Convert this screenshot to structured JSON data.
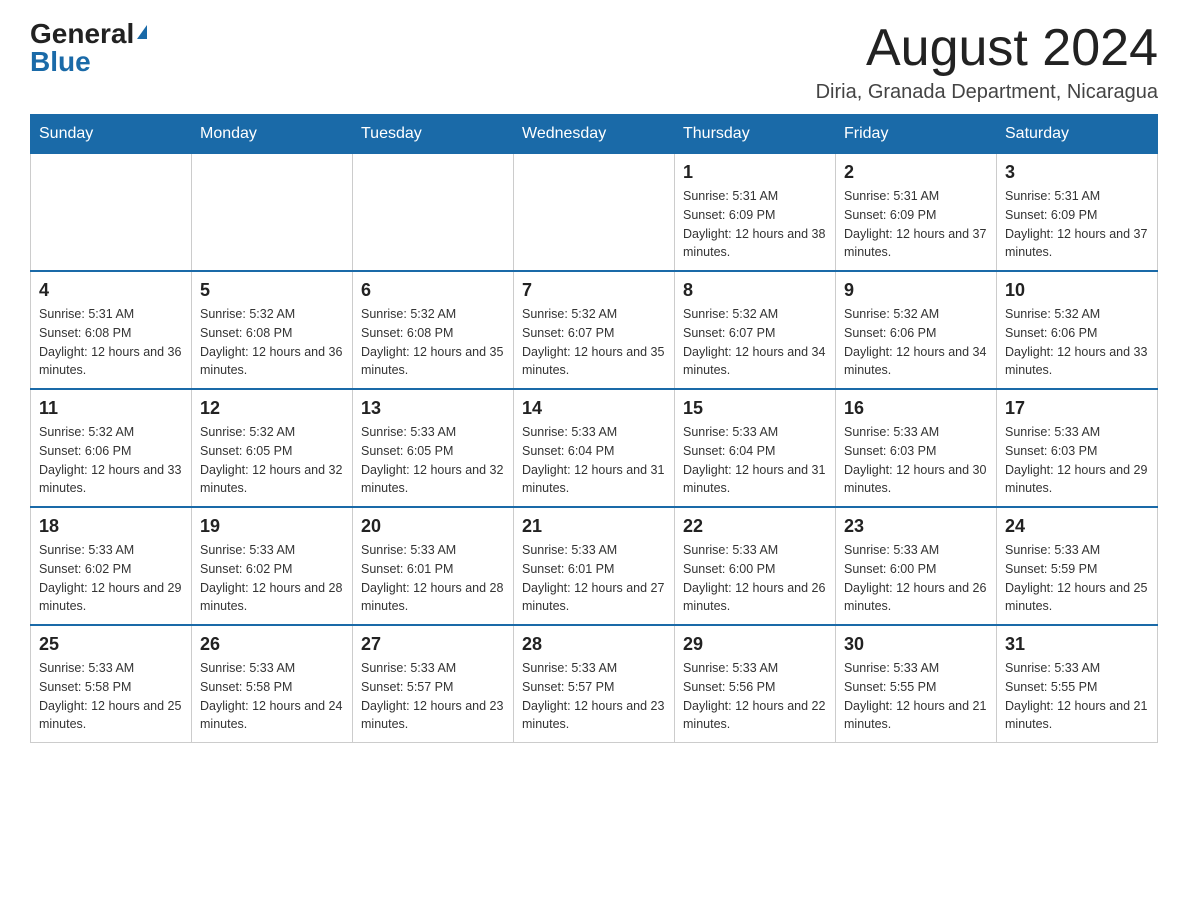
{
  "header": {
    "logo_general": "General",
    "logo_blue": "Blue",
    "title": "August 2024",
    "subtitle": "Diria, Granada Department, Nicaragua"
  },
  "days_of_week": [
    "Sunday",
    "Monday",
    "Tuesday",
    "Wednesday",
    "Thursday",
    "Friday",
    "Saturday"
  ],
  "weeks": [
    [
      {
        "day": "",
        "info": ""
      },
      {
        "day": "",
        "info": ""
      },
      {
        "day": "",
        "info": ""
      },
      {
        "day": "",
        "info": ""
      },
      {
        "day": "1",
        "info": "Sunrise: 5:31 AM\nSunset: 6:09 PM\nDaylight: 12 hours and 38 minutes."
      },
      {
        "day": "2",
        "info": "Sunrise: 5:31 AM\nSunset: 6:09 PM\nDaylight: 12 hours and 37 minutes."
      },
      {
        "day": "3",
        "info": "Sunrise: 5:31 AM\nSunset: 6:09 PM\nDaylight: 12 hours and 37 minutes."
      }
    ],
    [
      {
        "day": "4",
        "info": "Sunrise: 5:31 AM\nSunset: 6:08 PM\nDaylight: 12 hours and 36 minutes."
      },
      {
        "day": "5",
        "info": "Sunrise: 5:32 AM\nSunset: 6:08 PM\nDaylight: 12 hours and 36 minutes."
      },
      {
        "day": "6",
        "info": "Sunrise: 5:32 AM\nSunset: 6:08 PM\nDaylight: 12 hours and 35 minutes."
      },
      {
        "day": "7",
        "info": "Sunrise: 5:32 AM\nSunset: 6:07 PM\nDaylight: 12 hours and 35 minutes."
      },
      {
        "day": "8",
        "info": "Sunrise: 5:32 AM\nSunset: 6:07 PM\nDaylight: 12 hours and 34 minutes."
      },
      {
        "day": "9",
        "info": "Sunrise: 5:32 AM\nSunset: 6:06 PM\nDaylight: 12 hours and 34 minutes."
      },
      {
        "day": "10",
        "info": "Sunrise: 5:32 AM\nSunset: 6:06 PM\nDaylight: 12 hours and 33 minutes."
      }
    ],
    [
      {
        "day": "11",
        "info": "Sunrise: 5:32 AM\nSunset: 6:06 PM\nDaylight: 12 hours and 33 minutes."
      },
      {
        "day": "12",
        "info": "Sunrise: 5:32 AM\nSunset: 6:05 PM\nDaylight: 12 hours and 32 minutes."
      },
      {
        "day": "13",
        "info": "Sunrise: 5:33 AM\nSunset: 6:05 PM\nDaylight: 12 hours and 32 minutes."
      },
      {
        "day": "14",
        "info": "Sunrise: 5:33 AM\nSunset: 6:04 PM\nDaylight: 12 hours and 31 minutes."
      },
      {
        "day": "15",
        "info": "Sunrise: 5:33 AM\nSunset: 6:04 PM\nDaylight: 12 hours and 31 minutes."
      },
      {
        "day": "16",
        "info": "Sunrise: 5:33 AM\nSunset: 6:03 PM\nDaylight: 12 hours and 30 minutes."
      },
      {
        "day": "17",
        "info": "Sunrise: 5:33 AM\nSunset: 6:03 PM\nDaylight: 12 hours and 29 minutes."
      }
    ],
    [
      {
        "day": "18",
        "info": "Sunrise: 5:33 AM\nSunset: 6:02 PM\nDaylight: 12 hours and 29 minutes."
      },
      {
        "day": "19",
        "info": "Sunrise: 5:33 AM\nSunset: 6:02 PM\nDaylight: 12 hours and 28 minutes."
      },
      {
        "day": "20",
        "info": "Sunrise: 5:33 AM\nSunset: 6:01 PM\nDaylight: 12 hours and 28 minutes."
      },
      {
        "day": "21",
        "info": "Sunrise: 5:33 AM\nSunset: 6:01 PM\nDaylight: 12 hours and 27 minutes."
      },
      {
        "day": "22",
        "info": "Sunrise: 5:33 AM\nSunset: 6:00 PM\nDaylight: 12 hours and 26 minutes."
      },
      {
        "day": "23",
        "info": "Sunrise: 5:33 AM\nSunset: 6:00 PM\nDaylight: 12 hours and 26 minutes."
      },
      {
        "day": "24",
        "info": "Sunrise: 5:33 AM\nSunset: 5:59 PM\nDaylight: 12 hours and 25 minutes."
      }
    ],
    [
      {
        "day": "25",
        "info": "Sunrise: 5:33 AM\nSunset: 5:58 PM\nDaylight: 12 hours and 25 minutes."
      },
      {
        "day": "26",
        "info": "Sunrise: 5:33 AM\nSunset: 5:58 PM\nDaylight: 12 hours and 24 minutes."
      },
      {
        "day": "27",
        "info": "Sunrise: 5:33 AM\nSunset: 5:57 PM\nDaylight: 12 hours and 23 minutes."
      },
      {
        "day": "28",
        "info": "Sunrise: 5:33 AM\nSunset: 5:57 PM\nDaylight: 12 hours and 23 minutes."
      },
      {
        "day": "29",
        "info": "Sunrise: 5:33 AM\nSunset: 5:56 PM\nDaylight: 12 hours and 22 minutes."
      },
      {
        "day": "30",
        "info": "Sunrise: 5:33 AM\nSunset: 5:55 PM\nDaylight: 12 hours and 21 minutes."
      },
      {
        "day": "31",
        "info": "Sunrise: 5:33 AM\nSunset: 5:55 PM\nDaylight: 12 hours and 21 minutes."
      }
    ]
  ]
}
